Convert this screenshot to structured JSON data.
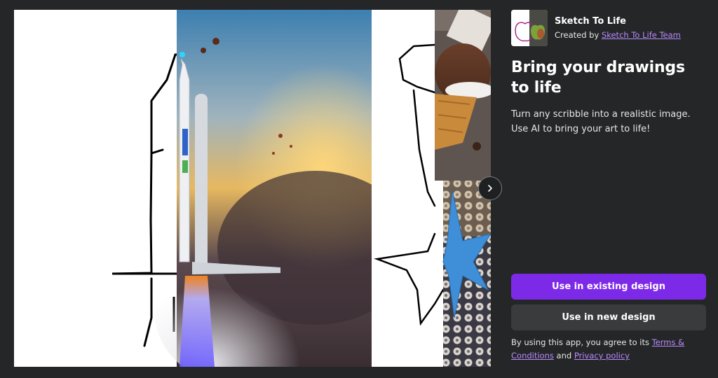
{
  "app": {
    "name": "Sketch To Life",
    "created_by_prefix": "Created by",
    "creator": "Sketch To Life Team",
    "icon": "apple-sketch-thumbnail"
  },
  "headline": "Bring your drawings to life",
  "description": "Turn any scribble into a realistic image. Use AI to bring your art to life!",
  "actions": {
    "existing_design": "Use in existing design",
    "new_design": "Use in new design"
  },
  "legal": {
    "prefix": "By using this app, you agree to its",
    "terms": "Terms & Conditions",
    "and": "and",
    "privacy": "Privacy policy"
  },
  "gallery": {
    "next_icon": "chevron-right-icon",
    "slides": [
      "rocket-sketch-to-photo",
      "ice-cream-and-starfish-sketch-to-photo"
    ]
  },
  "colors": {
    "background": "#252627",
    "accent": "#7d2ae8",
    "secondary_button": "#3a3b3d",
    "link": "#b78bff"
  }
}
